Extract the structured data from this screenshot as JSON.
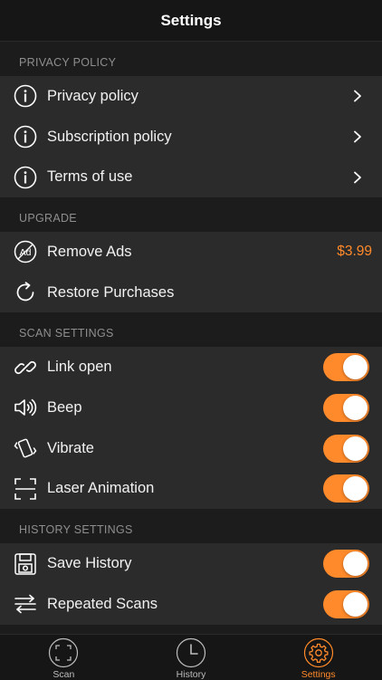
{
  "header": {
    "title": "Settings"
  },
  "colors": {
    "accent": "#ff8a2b",
    "background": "#1c1c1c",
    "row": "#2b2b2b",
    "section_text": "#8e8e8e"
  },
  "sections": {
    "privacy": {
      "title": "PRIVACY POLICY",
      "items": [
        {
          "label": "Privacy policy",
          "icon": "info-icon"
        },
        {
          "label": "Subscription policy",
          "icon": "info-icon"
        },
        {
          "label": "Terms of use",
          "icon": "info-icon"
        }
      ]
    },
    "upgrade": {
      "title": "UPGRADE",
      "items": [
        {
          "label": "Remove Ads",
          "icon": "no-ads-icon",
          "price": "$3.99"
        },
        {
          "label": "Restore Purchases",
          "icon": "restore-icon"
        }
      ]
    },
    "scan": {
      "title": "SCAN SETTINGS",
      "items": [
        {
          "label": "Link open",
          "icon": "link-icon",
          "enabled": true
        },
        {
          "label": "Beep",
          "icon": "speaker-icon",
          "enabled": true
        },
        {
          "label": "Vibrate",
          "icon": "vibrate-icon",
          "enabled": true
        },
        {
          "label": "Laser Animation",
          "icon": "scan-frame-icon",
          "enabled": true
        }
      ]
    },
    "history": {
      "title": "HISTORY SETTINGS",
      "items": [
        {
          "label": "Save History",
          "icon": "save-icon",
          "enabled": true
        },
        {
          "label": "Repeated Scans",
          "icon": "repeat-icon",
          "enabled": true
        }
      ]
    }
  },
  "tabs": [
    {
      "label": "Scan",
      "icon": "scan-icon",
      "active": false
    },
    {
      "label": "History",
      "icon": "clock-icon",
      "active": false
    },
    {
      "label": "Settings",
      "icon": "gear-icon",
      "active": true
    }
  ]
}
